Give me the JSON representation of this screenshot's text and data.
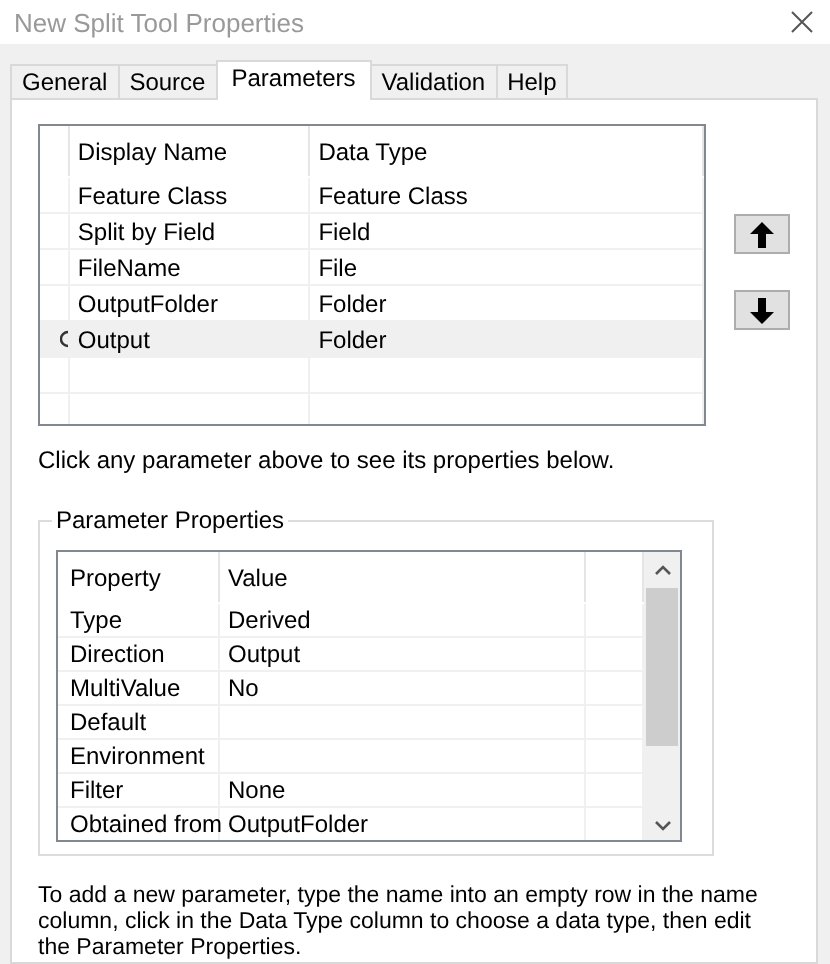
{
  "window": {
    "title": "New Split Tool Properties"
  },
  "tabs": [
    {
      "label": "General",
      "selected": false
    },
    {
      "label": "Source",
      "selected": false
    },
    {
      "label": "Parameters",
      "selected": true
    },
    {
      "label": "Validation",
      "selected": false
    },
    {
      "label": "Help",
      "selected": false
    }
  ],
  "parameters": {
    "columns": [
      "Display Name",
      "Data Type"
    ],
    "rows": [
      {
        "name": "Feature Class",
        "type": "Feature Class",
        "selected": false
      },
      {
        "name": "Split by Field",
        "type": "Field",
        "selected": false
      },
      {
        "name": "FileName",
        "type": "File",
        "selected": false
      },
      {
        "name": "OutputFolder",
        "type": "Folder",
        "selected": false
      },
      {
        "name": "Output",
        "type": "Folder",
        "selected": true
      }
    ]
  },
  "hint": "Click any parameter above to see its properties below.",
  "properties": {
    "title": "Parameter Properties",
    "columns": [
      "Property",
      "Value"
    ],
    "rows": [
      {
        "property": "Type",
        "value": "Derived"
      },
      {
        "property": "Direction",
        "value": "Output"
      },
      {
        "property": "MultiValue",
        "value": "No"
      },
      {
        "property": "Default"
      },
      {
        "property": "Environment"
      },
      {
        "property": "Filter",
        "value": "None"
      },
      {
        "property": "Obtained from",
        "value": "OutputFolder"
      }
    ]
  },
  "instructions": "To add a new parameter, type the name into an empty row in the name column, click in the Data Type column to choose a data type, then edit the Parameter Properties."
}
